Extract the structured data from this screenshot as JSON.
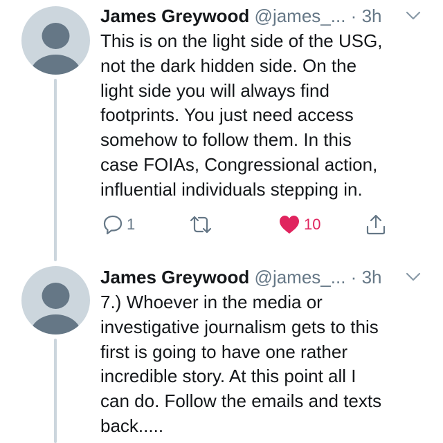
{
  "tweets": [
    {
      "name": "James Greywood",
      "handle": "@james_...",
      "separator": "·",
      "time": "3h",
      "text_lines": [
        "This is on the light side of the USG,",
        "not the dark hidden side. On the",
        "light side you will always find",
        "footprints. You just need access",
        "somehow to follow them. In this",
        "case FOIAs, Congressional action,",
        "influential individuals stepping in."
      ],
      "actions": {
        "reply": {
          "icon": "reply-icon",
          "count": "1"
        },
        "retweet": {
          "icon": "retweet-icon",
          "count": ""
        },
        "like": {
          "icon": "heart-icon",
          "count": "10",
          "liked": true
        },
        "share": {
          "icon": "share-icon"
        }
      }
    },
    {
      "name": "James Greywood",
      "handle": "@james_...",
      "separator": "·",
      "time": "3h",
      "text_lines": [
        "7.) Whoever in the media or",
        "investigative journalism gets to this",
        "first is going to have one rather",
        "incredible story. At this point all I",
        "can do. Follow the emails and texts",
        "back....."
      ]
    }
  ],
  "colors": {
    "text": "#14171a",
    "secondary": "#657786",
    "like": "#e0245e",
    "avatar_bg": "#ccd6dd",
    "avatar_fg": "#657786"
  }
}
